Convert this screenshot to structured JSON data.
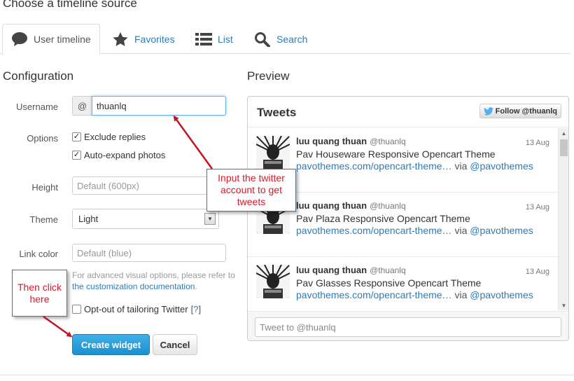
{
  "page": {
    "heading": "Choose a timeline source"
  },
  "tabs": [
    {
      "label": "User timeline",
      "icon": "speech-bubble-icon",
      "active": true
    },
    {
      "label": "Favorites",
      "icon": "star-icon",
      "active": false
    },
    {
      "label": "List",
      "icon": "list-icon",
      "active": false
    },
    {
      "label": "Search",
      "icon": "magnifier-icon",
      "active": false
    }
  ],
  "config": {
    "title": "Configuration",
    "username_label": "Username",
    "username_prefix": "@",
    "username_value": "thuanlq",
    "options_label": "Options",
    "opt_exclude_replies": "Exclude replies",
    "opt_auto_expand": "Auto-expand photos",
    "height_label": "Height",
    "height_placeholder": "Default (600px)",
    "theme_label": "Theme",
    "theme_value": "Light",
    "link_color_label": "Link color",
    "link_color_placeholder": "Default (blue)",
    "help_text": "For advanced visual options, please refer to",
    "help_link": "the customization documentation",
    "help_end": ".",
    "optout_label": "Opt-out of tailoring Twitter",
    "optout_open": "[",
    "optout_link": "?",
    "optout_close": "]",
    "create_button": "Create widget",
    "cancel_button": "Cancel"
  },
  "preview": {
    "title": "Preview",
    "widget_title": "Tweets",
    "follow_button": "Follow @thuanlq",
    "tweets": [
      {
        "name": "luu quang thuan",
        "handle": "@thuanlq",
        "date": "13 Aug",
        "text": "Pav Houseware Responsive Opencart Theme",
        "link": "pavothemes.com/opencart-theme…",
        "via": "via",
        "via_handle": "@pavothemes"
      },
      {
        "name": "luu quang thuan",
        "handle": "@thuanlq",
        "date": "13 Aug",
        "text": "Pav Plaza Responsive Opencart Theme",
        "link": "pavothemes.com/opencart-theme…",
        "via": "via",
        "via_handle": "@pavothemes"
      },
      {
        "name": "luu quang thuan",
        "handle": "@thuanlq",
        "date": "13 Aug",
        "text": "Pav Glasses Responsive Opencart Theme",
        "link": "pavothemes.com/opencart-theme…",
        "via": "via",
        "via_handle": "@pavothemes"
      }
    ],
    "tweet_to_placeholder": "Tweet to @thuanlq"
  },
  "annotations": {
    "callout_input": "Input the twitter account to get tweets",
    "callout_click": "Then click here"
  },
  "colors": {
    "link": "#2b7bb9",
    "primary_button": "#1c8fd0",
    "annotation_text": "#d8182b",
    "annotation_arrow": "#c0151f"
  }
}
